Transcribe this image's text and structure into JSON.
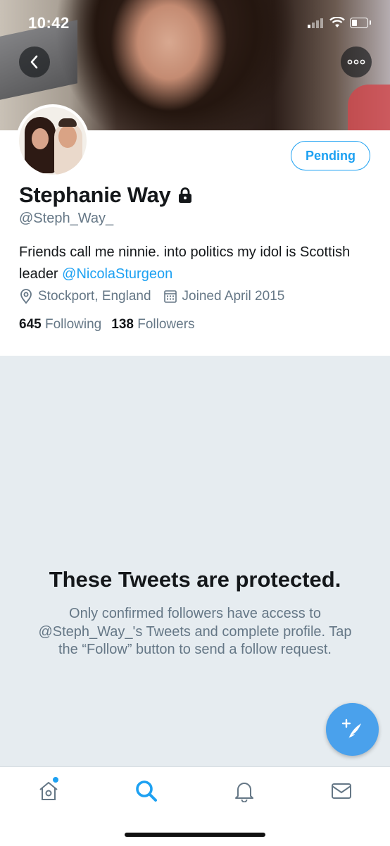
{
  "status_bar": {
    "time": "10:42"
  },
  "profile": {
    "name": "Stephanie Way",
    "handle": "@Steph_Way_",
    "bio_text": "Friends call me ninnie. into politics my idol is Scottish leader ",
    "bio_mention": "@NicolaSturgeon",
    "location": "Stockport, England",
    "joined": "Joined April 2015",
    "following_count": "645",
    "following_label": "Following",
    "followers_count": "138",
    "followers_label": "Followers",
    "follow_button_label": "Pending"
  },
  "protected": {
    "title": "These Tweets are protected.",
    "message": "Only confirmed followers have access to @Steph_Way_'s Tweets and complete profile. Tap the “Follow” button to send a follow request."
  },
  "icons": {
    "back": "chevron-left-icon",
    "more": "more-dots-icon",
    "lock": "lock-icon",
    "location": "location-pin-icon",
    "calendar": "calendar-icon",
    "compose": "compose-tweet-icon",
    "home": "home-icon",
    "search": "search-icon",
    "notifications": "bell-icon",
    "messages": "envelope-icon"
  },
  "colors": {
    "accent": "#1da1f2",
    "fab": "#4aa1ec",
    "secondary_text": "#657786",
    "protected_bg": "#e6ecf0"
  }
}
